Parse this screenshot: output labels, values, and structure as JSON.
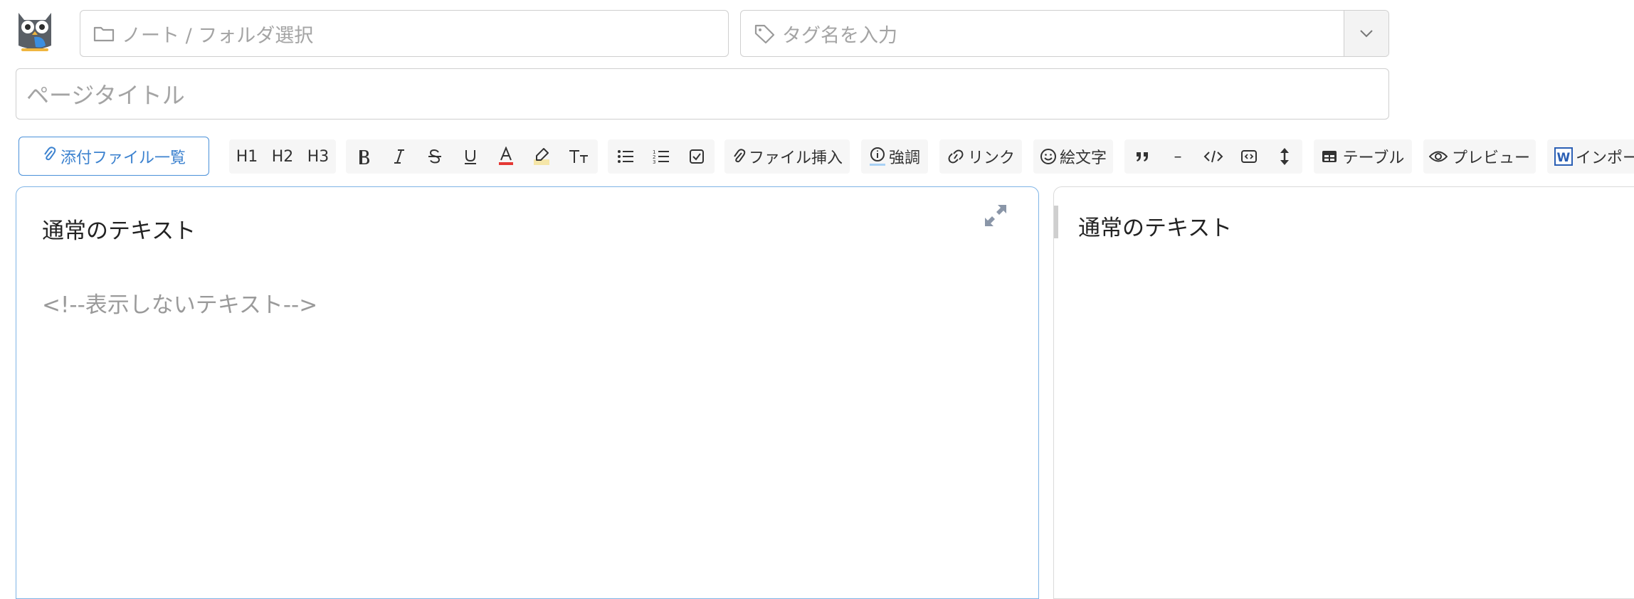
{
  "header": {
    "logo_icon": "owl-logo-icon",
    "note_folder": {
      "placeholder": "ノート / フォルダ選択",
      "icon": "folder-icon"
    },
    "tags": {
      "placeholder": "タグ名を入力",
      "icon": "tag-icon",
      "dropdown_icon": "chevron-down-icon"
    },
    "page_title": {
      "placeholder": "ページタイトル"
    }
  },
  "toolbar": {
    "attach_list_label": "添付ファイル一覧",
    "h1": "H1",
    "h2": "H2",
    "h3": "H3",
    "insert_file_label": "ファイル挿入",
    "emphasis_label": "強調",
    "link_label": "リンク",
    "emoji_label": "絵文字",
    "hr_label": "–",
    "table_label": "テーブル",
    "preview_label": "プレビュー",
    "import_label": "インポー",
    "accent_color": "#4a90d9",
    "font_color_underline": "#e53935",
    "highlight_color": "#f5e6a8"
  },
  "editor": {
    "lines": [
      "通常のテキスト",
      "<!--表示しないテキスト-->"
    ],
    "expand_icon": "expand-icon"
  },
  "preview": {
    "lines": [
      "通常のテキスト"
    ]
  }
}
